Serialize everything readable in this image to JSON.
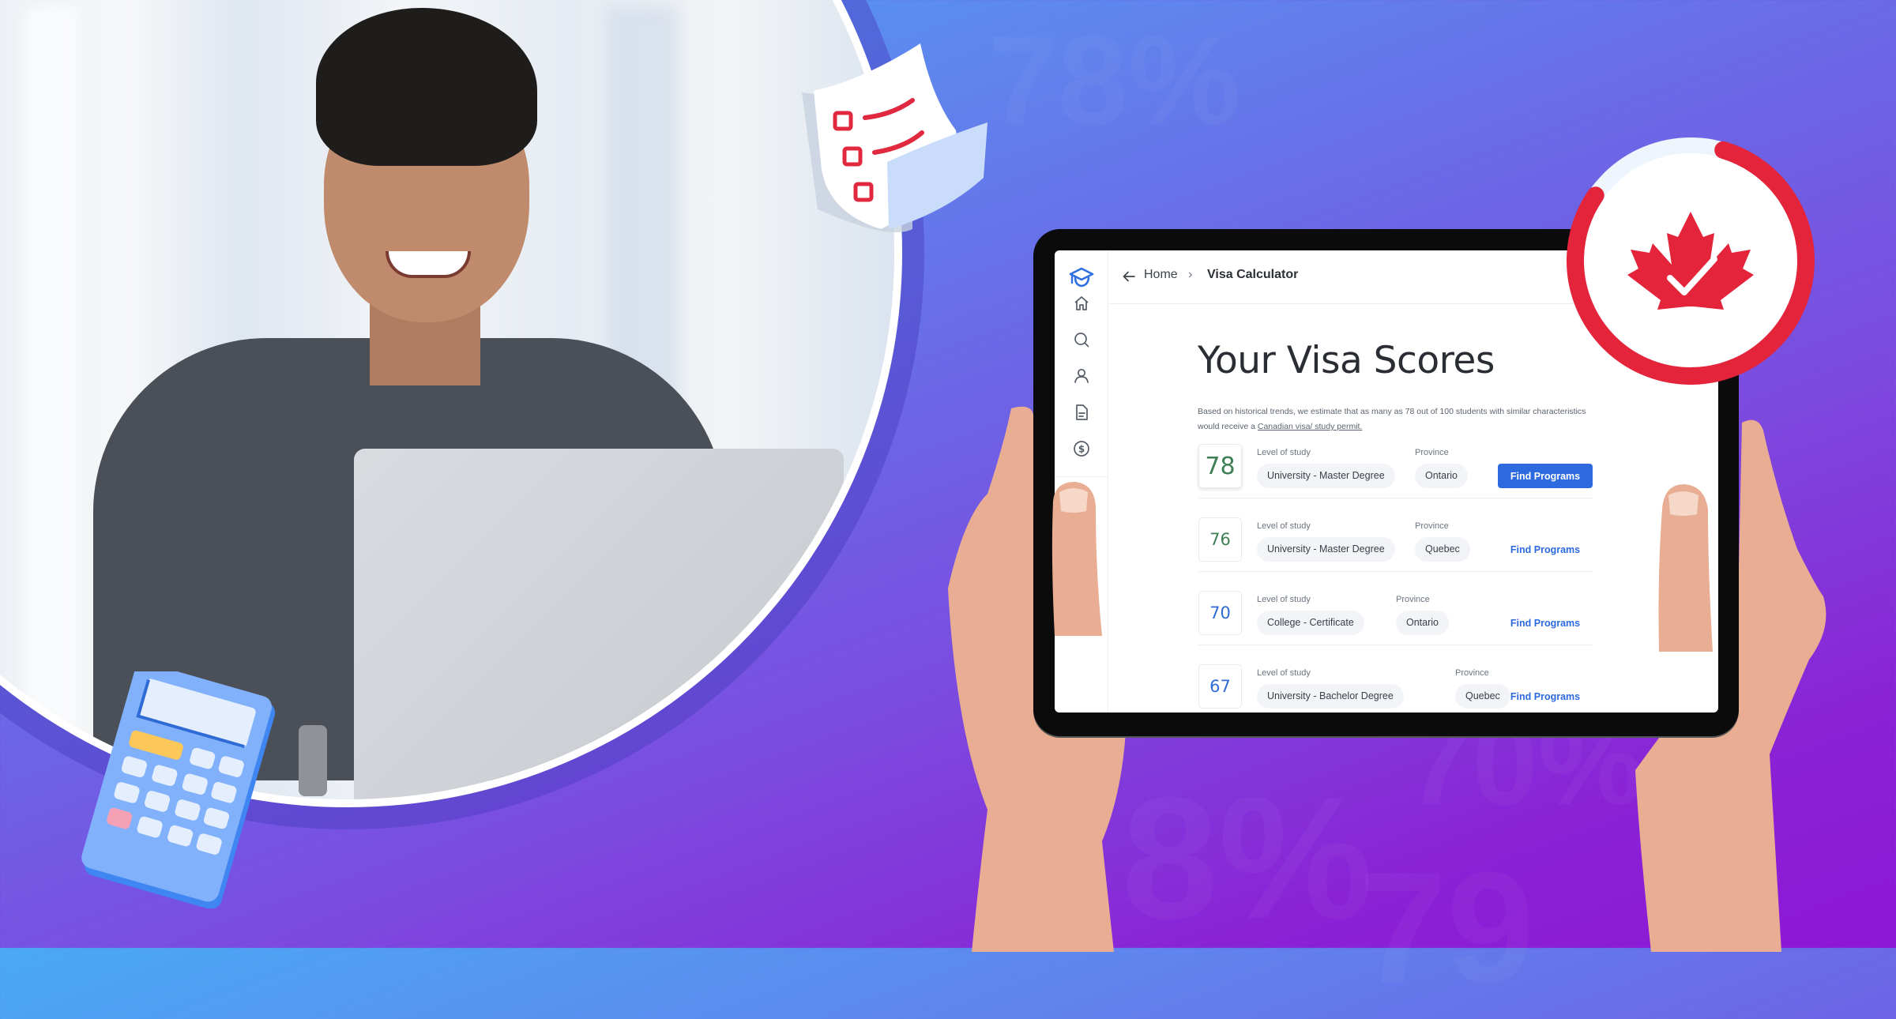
{
  "background": {
    "watermarks": [
      "78%",
      "70%",
      "8%",
      "79"
    ],
    "gradient_start": "#4aa9f6",
    "gradient_end": "#8e16d6"
  },
  "decorations": {
    "photo_subject": "smiling man working on laptop",
    "checklist_icon": "checklist-paper",
    "calculator_icon": "calculator",
    "badge_icon": "maple-leaf-check",
    "badge_progress": 0.8,
    "badge_color": "#e3243b"
  },
  "app": {
    "sidebar": {
      "logo": "graduation-cap-logo",
      "items": [
        {
          "icon": "home-icon",
          "label": "Home"
        },
        {
          "icon": "search-icon",
          "label": "Search"
        },
        {
          "icon": "user-icon",
          "label": "Profile"
        },
        {
          "icon": "document-icon",
          "label": "Documents"
        },
        {
          "icon": "dollar-icon",
          "label": "Payments"
        }
      ]
    },
    "breadcrumb": {
      "back_icon": "arrow-left-icon",
      "home": "Home",
      "separator": "›",
      "current": "Visa Calculator"
    },
    "title": "Your Visa Scores",
    "intro": {
      "text_before": "Based on historical trends, we estimate that as many as 78 out of 100 students with similar characteristics would receive a ",
      "link_text": "Canadian visa/ study permit."
    },
    "labels": {
      "level": "Level of study",
      "province": "Province",
      "action": "Find Programs"
    },
    "results": [
      {
        "score": "78",
        "level": "University - Master Degree",
        "province": "Ontario",
        "score_color": "#3f7f55",
        "primary": true
      },
      {
        "score": "76",
        "level": "University - Master Degree",
        "province": "Quebec",
        "score_color": "#3f7f55",
        "primary": false
      },
      {
        "score": "70",
        "level": "College - Certificate",
        "province": "Ontario",
        "score_color": "#2e6bd6",
        "primary": false
      },
      {
        "score": "67",
        "level": "University - Bachelor Degree",
        "province": "Quebec",
        "score_color": "#2e6bd6",
        "primary": false
      }
    ]
  }
}
